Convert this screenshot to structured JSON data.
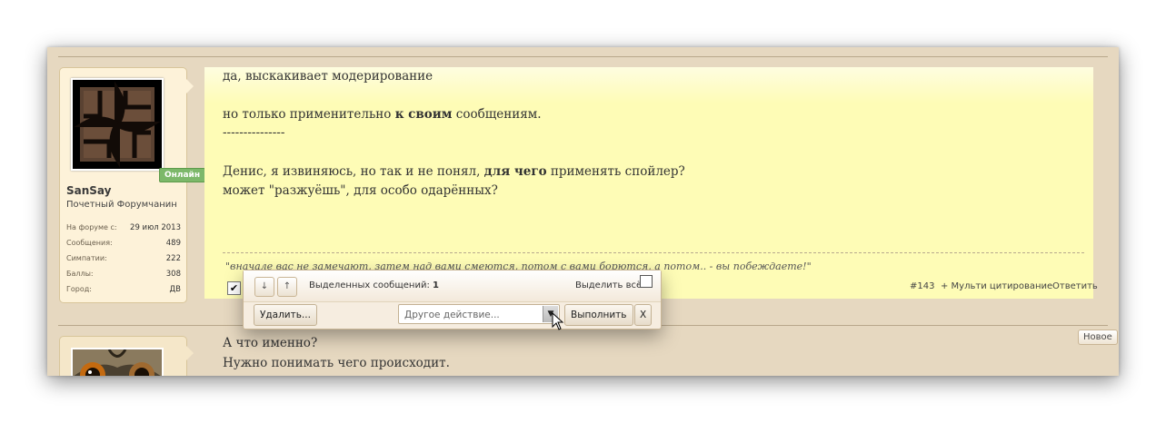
{
  "post1": {
    "lines": [
      {
        "parts": [
          {
            "t": "да, выскакивает модерирование",
            "b": false
          }
        ]
      },
      {
        "parts": [
          {
            "t": "но только применительно ",
            "b": false
          },
          {
            "t": "к своим",
            "b": true
          },
          {
            "t": " сообщениям.",
            "b": false
          }
        ]
      },
      {
        "parts": [
          {
            "t": "---------------",
            "b": false
          }
        ]
      },
      {
        "parts": [
          {
            "t": "Денис, я извиняюсь, но так и не понял, ",
            "b": false
          },
          {
            "t": "для чего",
            "b": true
          },
          {
            "t": " применять спойлер?",
            "b": false
          }
        ]
      },
      {
        "parts": [
          {
            "t": "может \"разжуёшь\", для особо одарённых?",
            "b": false
          }
        ]
      }
    ],
    "signature": "\"вначале вас не замечают, затем над вами смеются, потом с вами борются, а потом.. - вы побеждаете!\"",
    "number": "#143",
    "multiquote": "+ Мульти цитирование",
    "reply": "Ответить",
    "checkbox_checked": true
  },
  "user1": {
    "name": "SanSay",
    "title": "Почетный Форумчанин",
    "online": "Онлайн",
    "avatar_icon": "swirl-avatar",
    "stats": [
      {
        "label": "На форуме с:",
        "value": "29 июл 2013"
      },
      {
        "label": "Сообщения:",
        "value": "489"
      },
      {
        "label": "Симпатии:",
        "value": "222"
      },
      {
        "label": "Баллы:",
        "value": "308"
      },
      {
        "label": "Город:",
        "value": "ДВ"
      }
    ]
  },
  "popup": {
    "down_icon": "↓",
    "up_icon": "↑",
    "selected_label": "Выделенных сообщений:",
    "selected_count": "1",
    "select_all_label": "Выделить всё",
    "delete_btn": "Удалить...",
    "action_placeholder": "Другое действие...",
    "execute_btn": "Выполнить",
    "close_btn": "X"
  },
  "post2": {
    "lines": [
      "А что именно?",
      "Нужно понимать чего происходит."
    ],
    "new_badge": "Новое",
    "avatar_icon": "owl-avatar"
  }
}
